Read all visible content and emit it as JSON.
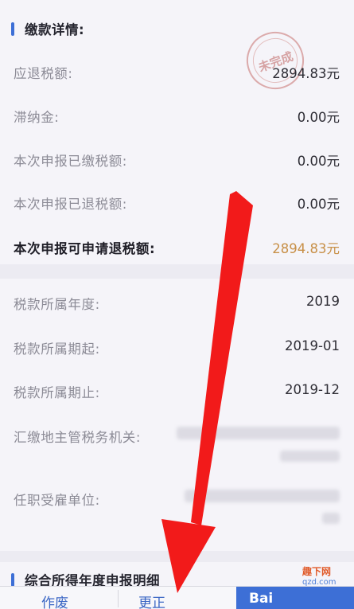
{
  "section1": {
    "title": "缴款详情:",
    "stamp": "未完成",
    "rows": [
      {
        "label": "应退税额:",
        "value": "2894.83元"
      },
      {
        "label": "滞纳金:",
        "value": "0.00元"
      },
      {
        "label": "本次申报已缴税额:",
        "value": "0.00元"
      },
      {
        "label": "本次申报已退税额:",
        "value": "0.00元"
      },
      {
        "label": "本次申报可申请退税额:",
        "value": "2894.83元"
      }
    ]
  },
  "section2": {
    "rows": [
      {
        "label": "税款所属年度:",
        "value": "2019"
      },
      {
        "label": "税款所属期起:",
        "value": "2019-01"
      },
      {
        "label": "税款所属期止:",
        "value": "2019-12"
      },
      {
        "label": "汇缴地主管税务机关:"
      },
      {
        "label": "任职受雇单位:"
      }
    ]
  },
  "section3": {
    "title": "综合所得年度申报明细"
  },
  "bottom_bar": {
    "cancel_label": "作废",
    "correct_label": "更正",
    "primary_label": "Bai"
  },
  "watermark": {
    "line1": "趣下网",
    "line2": "qzd.com"
  },
  "colors": {
    "accent": "#3d6fd6",
    "highlight_value": "#c89048",
    "arrow": "#f21a1a"
  }
}
